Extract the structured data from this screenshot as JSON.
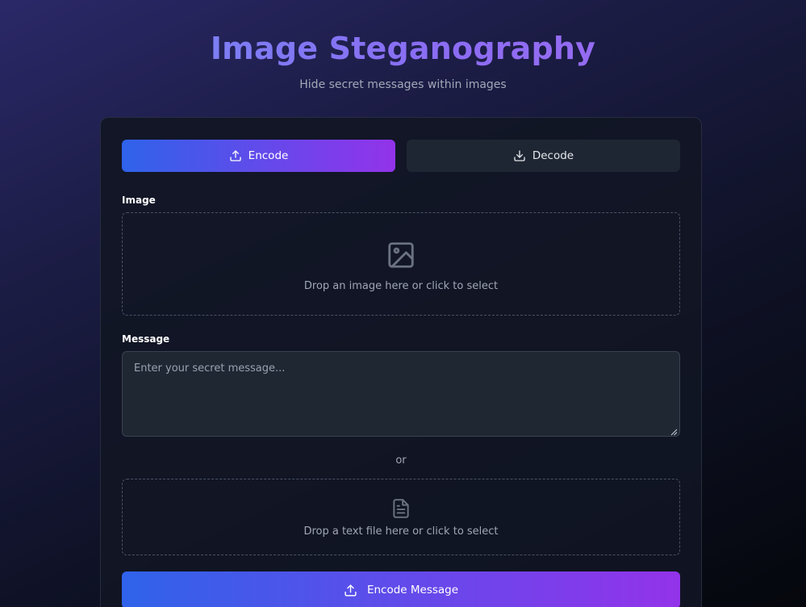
{
  "header": {
    "title": "Image Steganography",
    "subtitle": "Hide secret messages within images"
  },
  "tabs": [
    {
      "label": "Encode",
      "icon": "upload-icon",
      "active": true
    },
    {
      "label": "Decode",
      "icon": "download-icon",
      "active": false
    }
  ],
  "image_section": {
    "label": "Image",
    "dropzone_text": "Drop an image here or click to select",
    "icon": "image-icon"
  },
  "message_section": {
    "label": "Message",
    "placeholder": "Enter your secret message...",
    "value": ""
  },
  "divider_text": "or",
  "text_file_section": {
    "dropzone_text": "Drop a text file here or click to select",
    "icon": "file-text-icon"
  },
  "submit": {
    "label": "Encode Message",
    "icon": "upload-icon"
  },
  "colors": {
    "accent_start": "#2f63ea",
    "accent_end": "#9333ea",
    "card_bg": "#111624",
    "input_bg": "#1f2733"
  }
}
